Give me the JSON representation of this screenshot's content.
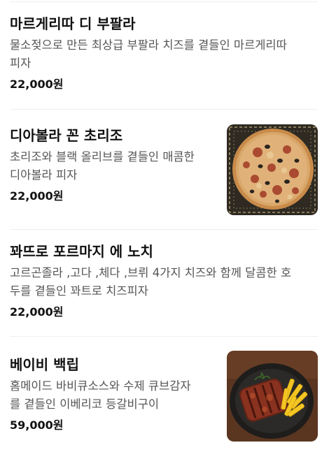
{
  "menu": {
    "items": [
      {
        "name": "마르게리따 디 부팔라",
        "desc_lines": [
          "물소젖으로 만든 최상급 부팔라 치즈를 곁들인 마르게리따",
          "피자"
        ],
        "price": "22,000원",
        "image": null
      },
      {
        "name": "디아볼라 꼰 초리조",
        "desc_lines": [
          "초리조와 블랙 올리브를 곁들인 매콤한",
          "디아볼라 피자"
        ],
        "price": "22,000원",
        "image": "pizza-photo"
      },
      {
        "name": "꽈뜨로 포르마지 에 노치",
        "desc_lines": [
          "고르곤졸라 ,고다 ,체다 ,브뤼 4가지 치즈와 함께 달콤한 호",
          "두를 곁들인 꽈트로 치즈피자"
        ],
        "price": "22,000원",
        "image": null
      },
      {
        "name": "베이비 백립",
        "desc_lines": [
          "홈메이드 바비큐소스와 수제 큐브감자",
          "를 곁들인 이베리코 등갈비구이"
        ],
        "price": "59,000원",
        "image": "ribs-photo"
      }
    ]
  },
  "colors": {
    "name": "#111111",
    "desc": "#555555",
    "divider": "#eeeeee"
  }
}
